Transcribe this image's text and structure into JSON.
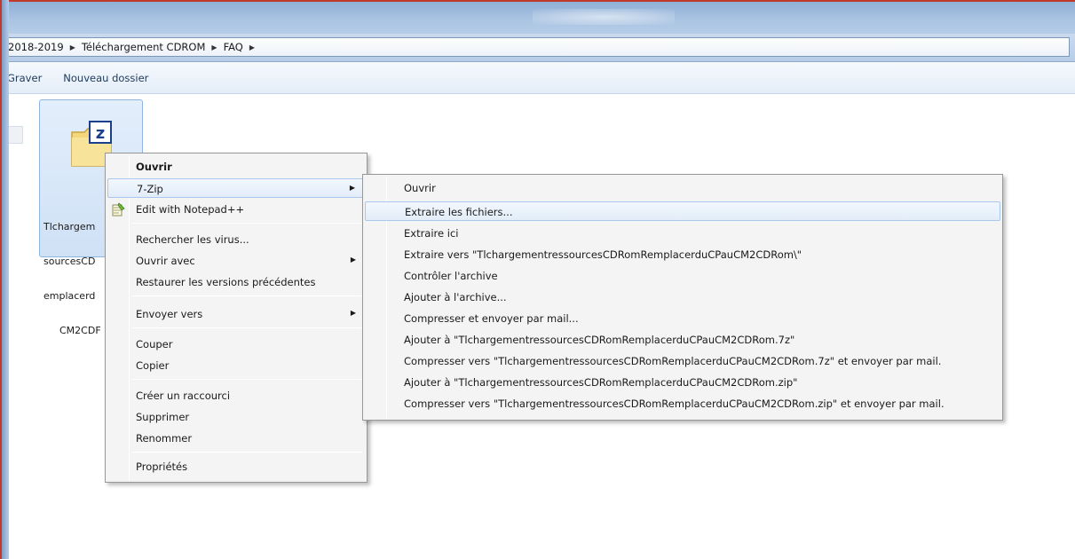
{
  "window": {
    "breadcrumb": [
      "2018-2019",
      "Téléchargement CDROM",
      "FAQ"
    ]
  },
  "toolbar": {
    "items": [
      "Graver",
      "Nouveau dossier"
    ]
  },
  "file": {
    "name_lines": [
      "Tlchargem",
      "sourcesCD",
      "emplacerd",
      "CM2CDF"
    ],
    "icon": "7zip-archive-icon"
  },
  "context_menu": {
    "items": [
      {
        "label": "Ouvrir",
        "bold": true
      },
      {
        "label": "7-Zip",
        "submenu": true,
        "highlighted": true
      },
      {
        "label": "Edit with Notepad++",
        "icon": "notepad-plus-plus-icon"
      },
      {
        "label": "Rechercher les virus..."
      },
      {
        "label": "Ouvrir avec",
        "submenu": true
      },
      {
        "label": "Restaurer les versions précédentes"
      },
      {
        "label": "Envoyer vers",
        "submenu": true
      },
      {
        "label": "Couper"
      },
      {
        "label": "Copier"
      },
      {
        "label": "Créer un raccourci"
      },
      {
        "label": "Supprimer"
      },
      {
        "label": "Renommer"
      },
      {
        "label": "Propriétés"
      }
    ]
  },
  "zip_submenu": {
    "items": [
      "Ouvrir",
      "Extraire les fichiers...",
      "Extraire ici",
      "Extraire vers \"TlchargementressourcesCDRomRemplacerduCPauCM2CDRom\\\"",
      "Contrôler l'archive",
      "Ajouter à l'archive...",
      "Compresser et envoyer par mail...",
      "Ajouter à \"TlchargementressourcesCDRomRemplacerduCPauCM2CDRom.7z\"",
      "Compresser vers \"TlchargementressourcesCDRomRemplacerduCPauCM2CDRom.7z\" et envoyer par mail.",
      "Ajouter à \"TlchargementressourcesCDRomRemplacerduCPauCM2CDRom.zip\"",
      "Compresser vers \"TlchargementressourcesCDRomRemplacerduCPauCM2CDRom.zip\" et envoyer par mail."
    ],
    "highlighted_index": 1
  }
}
